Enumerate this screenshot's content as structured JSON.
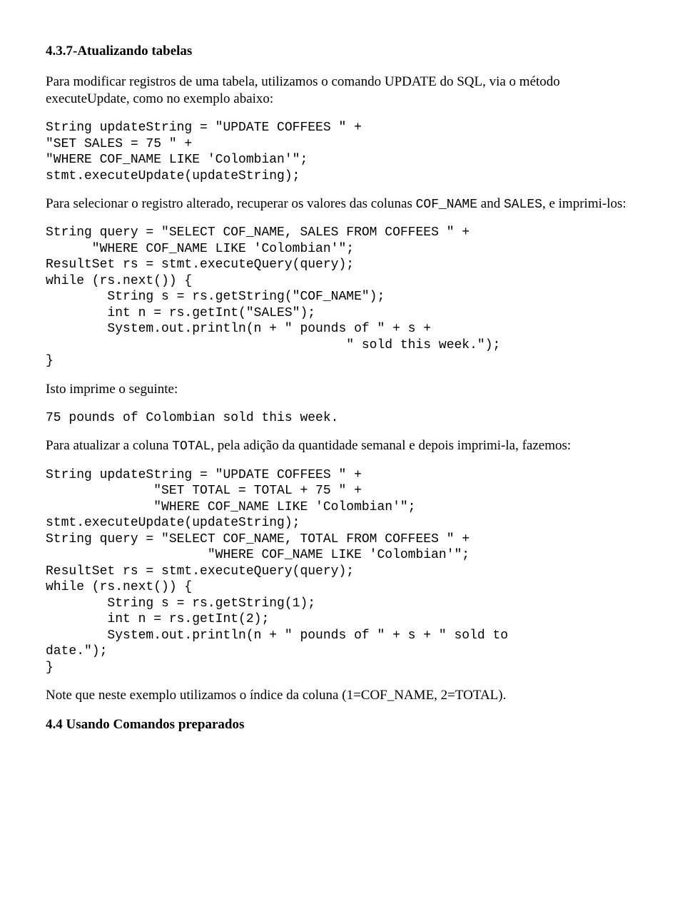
{
  "heading_437": "4.3.7-Atualizando tabelas",
  "para_intro_437": "Para modificar registros de uma tabela, utilizamos o comando UPDATE  do SQL, via o método executeUpdate, como no exemplo abaixo:",
  "code_update1": "String updateString = \"UPDATE COFFEES \" + \n\"SET SALES = 75 \" + \n\"WHERE COF_NAME LIKE 'Colombian'\";\nstmt.executeUpdate(updateString);",
  "para_select_prefix": "Para selecionar o registro alterado, recuperar os valores das colunas ",
  "mono_cofname": "COF_NAME",
  "para_and": " and ",
  "mono_sales": "SALES",
  "para_select_suffix": ", e imprimi-los:",
  "code_select1": "String query = \"SELECT COF_NAME, SALES FROM COFFEES \" + \n      \"WHERE COF_NAME LIKE 'Colombian'\";\nResultSet rs = stmt.executeQuery(query);\nwhile (rs.next()) {\n        String s = rs.getString(\"COF_NAME\");\n        int n = rs.getInt(\"SALES\");\n        System.out.println(n + \" pounds of \" + s +\n                                       \" sold this week.\");\n}",
  "para_prints": "Isto imprime o seguinte:",
  "code_output": "75 pounds of Colombian sold this week.",
  "para_total_prefix": "Para atualizar a coluna ",
  "mono_total": "TOTAL",
  "para_total_suffix": ", pela adição da quantidade semanal e depois imprimi-la, fazemos:",
  "code_update2": "String updateString = \"UPDATE COFFEES \" + \n              \"SET TOTAL = TOTAL + 75 \" +\n              \"WHERE COF_NAME LIKE 'Colombian'\";\nstmt.executeUpdate(updateString);\nString query = \"SELECT COF_NAME, TOTAL FROM COFFEES \" +\n                     \"WHERE COF_NAME LIKE 'Colombian'\";\nResultSet rs = stmt.executeQuery(query);\nwhile (rs.next()) {\n        String s = rs.getString(1);\n        int n = rs.getInt(2);\n        System.out.println(n + \" pounds of \" + s + \" sold to \ndate.\");\n}",
  "para_note": "Note que neste exemplo utilizamos o índice da coluna (1=COF_NAME, 2=TOTAL).",
  "heading_44": "4.4 Usando Comandos preparados"
}
